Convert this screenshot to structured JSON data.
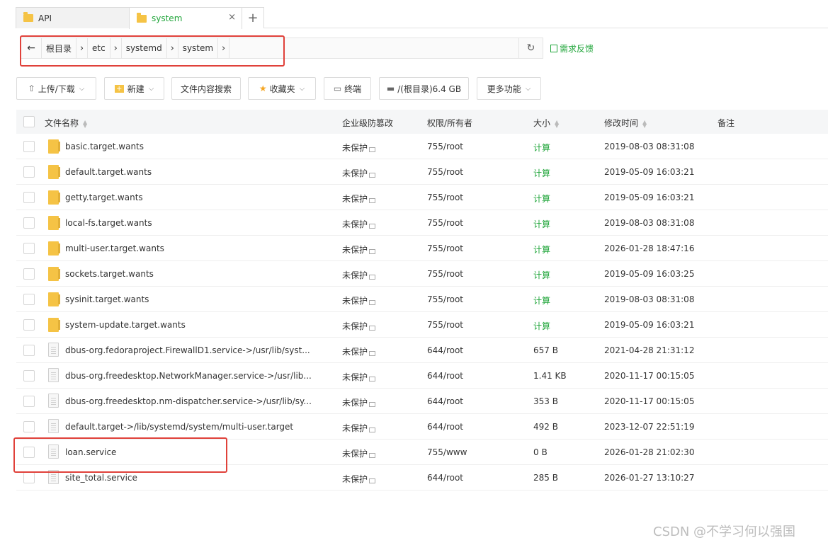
{
  "tabs": [
    {
      "label": "API",
      "active": false
    },
    {
      "label": "system",
      "active": true
    }
  ],
  "add_tab_label": "+",
  "close_label": "×",
  "path": {
    "back_icon": "arrow-left-icon",
    "crumbs": [
      "根目录",
      "etc",
      "systemd",
      "system"
    ],
    "refresh_icon": "refresh-icon"
  },
  "feedback_label": "需求反馈",
  "toolbar": {
    "upload_label": "上传/下载",
    "new_label": "新建",
    "search_label": "文件内容搜索",
    "favorites_label": "收藏夹",
    "terminal_label": "终端",
    "disk_label": "/(根目录)6.4 GB",
    "more_label": "更多功能"
  },
  "table": {
    "headers": {
      "name": "文件名称",
      "protect": "企业级防篡改",
      "perm": "权限/所有者",
      "size": "大小",
      "mtime": "修改时间",
      "note": "备注"
    },
    "rows": [
      {
        "type": "folder",
        "name": "basic.target.wants",
        "protect": "未保护",
        "perm": "755/root",
        "size": "计算",
        "mtime": "2019-08-03 08:31:08"
      },
      {
        "type": "folder",
        "name": "default.target.wants",
        "protect": "未保护",
        "perm": "755/root",
        "size": "计算",
        "mtime": "2019-05-09 16:03:21"
      },
      {
        "type": "folder",
        "name": "getty.target.wants",
        "protect": "未保护",
        "perm": "755/root",
        "size": "计算",
        "mtime": "2019-05-09 16:03:21"
      },
      {
        "type": "folder",
        "name": "local-fs.target.wants",
        "protect": "未保护",
        "perm": "755/root",
        "size": "计算",
        "mtime": "2019-08-03 08:31:08"
      },
      {
        "type": "folder",
        "name": "multi-user.target.wants",
        "protect": "未保护",
        "perm": "755/root",
        "size": "计算",
        "mtime": "2026-01-28 18:47:16"
      },
      {
        "type": "folder",
        "name": "sockets.target.wants",
        "protect": "未保护",
        "perm": "755/root",
        "size": "计算",
        "mtime": "2019-05-09 16:03:25"
      },
      {
        "type": "folder",
        "name": "sysinit.target.wants",
        "protect": "未保护",
        "perm": "755/root",
        "size": "计算",
        "mtime": "2019-08-03 08:31:08"
      },
      {
        "type": "folder",
        "name": "system-update.target.wants",
        "protect": "未保护",
        "perm": "755/root",
        "size": "计算",
        "mtime": "2019-05-09 16:03:21"
      },
      {
        "type": "file",
        "name": "dbus-org.fedoraproject.FirewallD1.service->/usr/lib/syst...",
        "protect": "未保护",
        "perm": "644/root",
        "size": "657 B",
        "mtime": "2021-04-28 21:31:12"
      },
      {
        "type": "file",
        "name": "dbus-org.freedesktop.NetworkManager.service->/usr/lib...",
        "protect": "未保护",
        "perm": "644/root",
        "size": "1.41 KB",
        "mtime": "2020-11-17 00:15:05"
      },
      {
        "type": "file",
        "name": "dbus-org.freedesktop.nm-dispatcher.service->/usr/lib/sy...",
        "protect": "未保护",
        "perm": "644/root",
        "size": "353 B",
        "mtime": "2020-11-17 00:15:05"
      },
      {
        "type": "file",
        "name": "default.target->/lib/systemd/system/multi-user.target",
        "protect": "未保护",
        "perm": "644/root",
        "size": "492 B",
        "mtime": "2023-12-07 22:51:19"
      },
      {
        "type": "file",
        "name": "loan.service",
        "protect": "未保护",
        "perm": "755/www",
        "size": "0 B",
        "mtime": "2026-01-28 21:02:30"
      },
      {
        "type": "file",
        "name": "site_total.service",
        "protect": "未保护",
        "perm": "644/root",
        "size": "285 B",
        "mtime": "2026-01-27 13:10:27"
      }
    ]
  },
  "watermark": "CSDN @不学习何以强国",
  "colors": {
    "accent": "#20a53a",
    "folder": "#f5c345",
    "highlight": "#e0413a"
  }
}
